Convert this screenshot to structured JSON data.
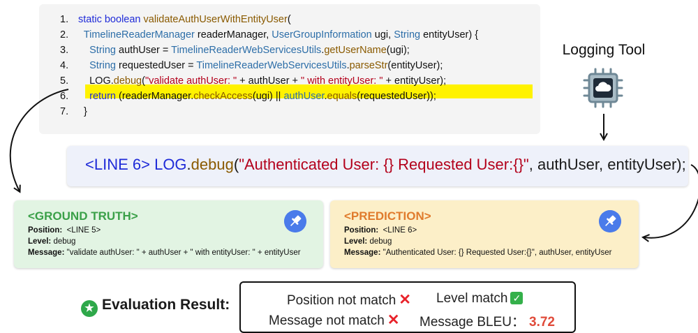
{
  "code": {
    "lines": [
      {
        "n": "1.",
        "parts": [
          {
            "t": "static boolean ",
            "c": "kw"
          },
          {
            "t": "validateAuthUserWithEntityUser",
            "c": "mt"
          },
          {
            "t": "(",
            "c": "vr"
          }
        ]
      },
      {
        "n": "2.",
        "parts": [
          {
            "t": "  TimelineReaderManager ",
            "c": "ty"
          },
          {
            "t": "readerManager",
            "c": "vr"
          },
          {
            "t": ", ",
            "c": "vr"
          },
          {
            "t": "UserGroupInformation ",
            "c": "ty"
          },
          {
            "t": "ugi",
            "c": "vr"
          },
          {
            "t": ", ",
            "c": "vr"
          },
          {
            "t": "String ",
            "c": "ty"
          },
          {
            "t": "entityUser",
            "c": "vr"
          },
          {
            "t": ") {",
            "c": "vr"
          }
        ]
      },
      {
        "n": "3.",
        "parts": [
          {
            "t": "    String ",
            "c": "ty"
          },
          {
            "t": "authUser",
            "c": "vr"
          },
          {
            "t": " = ",
            "c": "vr"
          },
          {
            "t": "TimelineReaderWebServicesUtils",
            "c": "ty"
          },
          {
            "t": ".",
            "c": "vr"
          },
          {
            "t": "getUserName",
            "c": "mt"
          },
          {
            "t": "(ugi);",
            "c": "vr"
          }
        ]
      },
      {
        "n": "4.",
        "parts": [
          {
            "t": "    String ",
            "c": "ty"
          },
          {
            "t": "requestedUser",
            "c": "vr"
          },
          {
            "t": " = ",
            "c": "vr"
          },
          {
            "t": "TimelineReaderWebServicesUtils",
            "c": "ty"
          },
          {
            "t": ".",
            "c": "vr"
          },
          {
            "t": "parseStr",
            "c": "mt"
          },
          {
            "t": "(entityUser);",
            "c": "vr"
          }
        ]
      },
      {
        "n": "5.",
        "parts": [
          {
            "t": "    LOG",
            "c": "vr"
          },
          {
            "t": ".",
            "c": "vr"
          },
          {
            "t": "debug",
            "c": "mt"
          },
          {
            "t": "(",
            "c": "vr"
          },
          {
            "t": "\"validate authUser: \"",
            "c": "st"
          },
          {
            "t": " + authUser + ",
            "c": "vr"
          },
          {
            "t": "\" with entityUser: \"",
            "c": "st"
          },
          {
            "t": " + entityUser);",
            "c": "vr"
          }
        ]
      },
      {
        "n": "6.",
        "parts": [
          {
            "t": "    return ",
            "c": "kw"
          },
          {
            "t": "(readerManager.",
            "c": "vr"
          },
          {
            "t": "checkAccess",
            "c": "mt"
          },
          {
            "t": "(ugi) || ",
            "c": "vr"
          },
          {
            "t": "authUser",
            "c": "ty"
          },
          {
            "t": ".",
            "c": "vr"
          },
          {
            "t": "equals",
            "c": "mt"
          },
          {
            "t": "(requestedUser));",
            "c": "vr"
          }
        ]
      },
      {
        "n": "7.",
        "parts": [
          {
            "t": "  }",
            "c": "vr"
          }
        ]
      }
    ]
  },
  "tool": {
    "title": "Logging Tool",
    "icon": "cloud-chip-icon"
  },
  "prediction_line": {
    "tag": "<LINE 6> ",
    "obj": "LOG",
    "dot": ".",
    "method": "debug",
    "open": "(",
    "message": "\"Authenticated User: {} Requested User:{}\"",
    "rest": ", authUser, entityUser);"
  },
  "ground_truth": {
    "title": "<GROUND TRUTH>",
    "position_label": "Position:",
    "position": "<LINE 5>",
    "level_label": "Level:",
    "level": "debug",
    "message_label": "Message:",
    "message": "\"validate authUser: \" + authUser + \" with entityUser: \" + entityUser"
  },
  "prediction": {
    "title": "<PREDICTION>",
    "position_label": "Position:",
    "position": "<LINE 6>",
    "level_label": "Level:",
    "level": "debug",
    "message_label": "Message:",
    "message": "\"Authenticated User: {} Requested User:{}\", authUser, entityUser"
  },
  "evaluation": {
    "label": "Evaluation Result:",
    "position": "Position not match",
    "level": "Level match",
    "message": "Message not match",
    "bleu_label": "Message BLEU：",
    "bleu_value": "3.72"
  },
  "colors": {
    "keyword": "#1f2bd8",
    "type": "#2d6ea8",
    "method": "#8a5a00",
    "string": "#b3001b",
    "highlight": "#fff200",
    "gt_title": "#3aa048",
    "pred_title": "#e07b2d",
    "bleu": "#e04b3a"
  }
}
